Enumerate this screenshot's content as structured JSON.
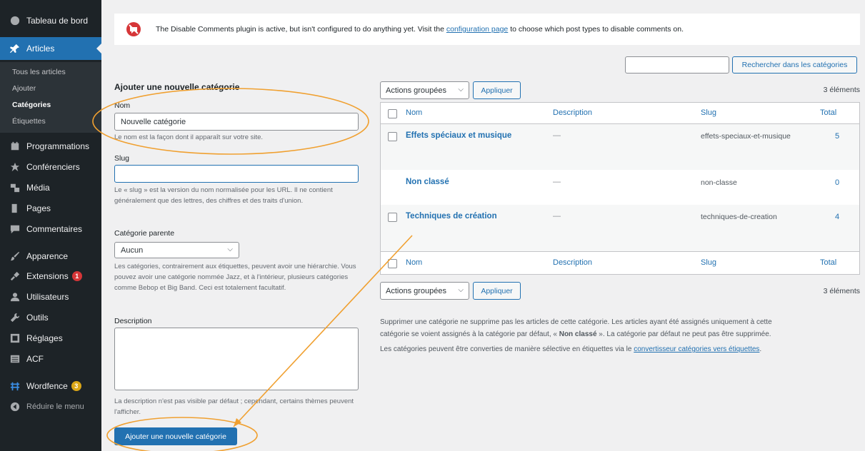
{
  "sidebar": {
    "dashboard": "Tableau de bord",
    "articles": "Articles",
    "submenu": [
      "Tous les articles",
      "Ajouter",
      "Catégories",
      "Étiquettes"
    ],
    "programmations": "Programmations",
    "conferenciers": "Conférenciers",
    "media": "Média",
    "pages": "Pages",
    "commentaires": "Commentaires",
    "apparence": "Apparence",
    "extensions": "Extensions",
    "extensions_badge": "1",
    "utilisateurs": "Utilisateurs",
    "outils": "Outils",
    "reglages": "Réglages",
    "acf": "ACF",
    "wordfence": "Wordfence",
    "wordfence_badge": "3",
    "collapse": "Réduire le menu"
  },
  "notice": {
    "text_before": "The Disable Comments plugin is active, but isn't configured to do anything yet. Visit the ",
    "link": "configuration page",
    "text_after": " to choose which post types to disable comments on."
  },
  "search": {
    "button": "Rechercher dans les catégories"
  },
  "form": {
    "title": "Ajouter une nouvelle catégorie",
    "name_label": "Nom",
    "name_value": "Nouvelle catégorie",
    "name_help": "Le nom est la façon dont il apparaît sur votre site.",
    "slug_label": "Slug",
    "slug_help": "Le « slug » est la version du nom normalisée pour les URL. Il ne contient généralement que des lettres, des chiffres et des traits d'union.",
    "parent_label": "Catégorie parente",
    "parent_value": "Aucun",
    "parent_help": "Les catégories, contrairement aux étiquettes, peuvent avoir une hiérarchie. Vous pouvez avoir une catégorie nommée Jazz, et à l'intérieur, plusieurs catégories comme Bebop et Big Band. Ceci est totalement facultatif.",
    "description_label": "Description",
    "description_help": "La description n'est pas visible par défaut ; cependant, certains thèmes peuvent l'afficher.",
    "submit": "Ajouter une nouvelle catégorie"
  },
  "table": {
    "bulk_label": "Actions groupées",
    "apply": "Appliquer",
    "count": "3 éléments",
    "headers": {
      "name": "Nom",
      "description": "Description",
      "slug": "Slug",
      "total": "Total"
    },
    "rows": [
      {
        "name": "Effets spéciaux et musique",
        "description": "—",
        "slug": "effets-speciaux-et-musique",
        "total": "5"
      },
      {
        "name": "Non classé",
        "description": "—",
        "slug": "non-classe",
        "total": "0"
      },
      {
        "name": "Techniques de création",
        "description": "—",
        "slug": "techniques-de-creation",
        "total": "4"
      }
    ]
  },
  "info": {
    "line1": "Supprimer une catégorie ne supprime pas les articles de cette catégorie. Les articles ayant été assignés uniquement à cette",
    "line2_before": "catégorie se voient assignés à la catégorie par défaut, « ",
    "line2_bold": "Non classé",
    "line2_after": " ». La catégorie par défaut ne peut pas être supprimée.",
    "line3_before": "Les catégories peuvent être converties de manière sélective en étiquettes via le ",
    "line3_link": "convertisseur catégories vers étiquettes",
    "line3_after": "."
  },
  "colors": {
    "sidebar_bg": "#1d2327",
    "accent": "#2271b1",
    "annotation": "#f0a030"
  },
  "icons": {
    "dashboard": "palette-icon",
    "articles": "pin-icon",
    "programmations": "calendar-icon",
    "conferenciers": "star-icon",
    "media": "media-icon",
    "pages": "pages-icon",
    "commentaires": "comment-icon",
    "apparence": "brush-icon",
    "extensions": "plug-icon",
    "utilisateurs": "user-icon",
    "outils": "wrench-icon",
    "reglages": "settings-icon",
    "acf": "acf-icon",
    "wordfence": "wordfence-icon",
    "collapse": "collapse-icon"
  }
}
